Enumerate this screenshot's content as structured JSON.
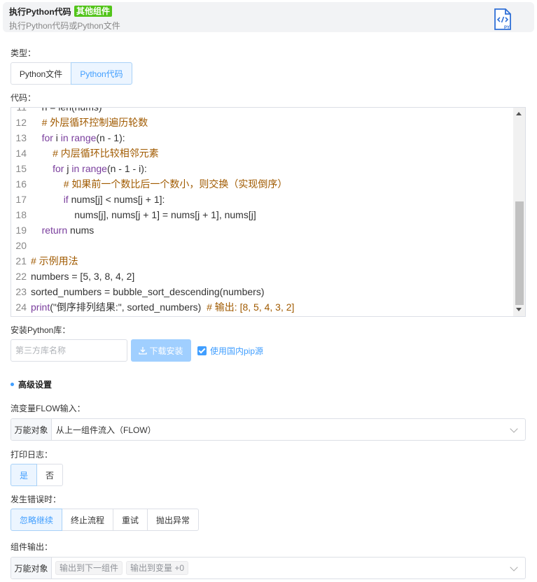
{
  "header": {
    "title": "执行Python代码",
    "badge": "其他组件",
    "subtitle": "执行Python代码或Python文件",
    "icon": "python-file-icon"
  },
  "type_field": {
    "label": "类型：",
    "options": [
      "Python文件",
      "Python代码"
    ],
    "selected": "Python代码"
  },
  "code_field": {
    "label": "代码：",
    "lines": [
      {
        "n": "11",
        "indent": "    ",
        "parts": [
          {
            "t": "n = len(nums)",
            "c": "code"
          }
        ]
      },
      {
        "n": "12",
        "indent": "    ",
        "parts": [
          {
            "t": "# 外层循环控制遍历轮数",
            "c": "cm"
          }
        ]
      },
      {
        "n": "13",
        "indent": "    ",
        "parts": [
          {
            "t": "for",
            "c": "kw"
          },
          {
            "t": " i ",
            "c": "code"
          },
          {
            "t": "in",
            "c": "kw"
          },
          {
            "t": " ",
            "c": "code"
          },
          {
            "t": "range",
            "c": "kw"
          },
          {
            "t": "(n - 1):",
            "c": "code"
          }
        ]
      },
      {
        "n": "14",
        "indent": "        ",
        "parts": [
          {
            "t": "# 内层循环比较相邻元素",
            "c": "cm"
          }
        ]
      },
      {
        "n": "15",
        "indent": "        ",
        "parts": [
          {
            "t": "for",
            "c": "kw"
          },
          {
            "t": " j ",
            "c": "code"
          },
          {
            "t": "in",
            "c": "kw"
          },
          {
            "t": " ",
            "c": "code"
          },
          {
            "t": "range",
            "c": "kw"
          },
          {
            "t": "(n - 1 - i):",
            "c": "code"
          }
        ]
      },
      {
        "n": "16",
        "indent": "            ",
        "parts": [
          {
            "t": "# 如果前一个数比后一个数小，则交换（实现倒序）",
            "c": "cm"
          }
        ]
      },
      {
        "n": "17",
        "indent": "            ",
        "parts": [
          {
            "t": "if",
            "c": "kw"
          },
          {
            "t": " nums[j] < nums[j + 1]:",
            "c": "code"
          }
        ]
      },
      {
        "n": "18",
        "indent": "                ",
        "parts": [
          {
            "t": "nums[j], nums[j + 1] = nums[j + 1], nums[j]",
            "c": "code"
          }
        ]
      },
      {
        "n": "19",
        "indent": "    ",
        "parts": [
          {
            "t": "return",
            "c": "kw"
          },
          {
            "t": " nums",
            "c": "code"
          }
        ]
      },
      {
        "n": "20",
        "indent": "",
        "parts": []
      },
      {
        "n": "21",
        "indent": "",
        "parts": [
          {
            "t": "# 示例用法",
            "c": "cm"
          }
        ]
      },
      {
        "n": "22",
        "indent": "",
        "parts": [
          {
            "t": "numbers = [5, 3, 8, 4, 2]",
            "c": "code"
          }
        ]
      },
      {
        "n": "23",
        "indent": "",
        "parts": [
          {
            "t": "sorted_numbers = bubble_sort_descending(numbers)",
            "c": "code"
          }
        ]
      },
      {
        "n": "24",
        "indent": "",
        "parts": [
          {
            "t": "print",
            "c": "kw"
          },
          {
            "t": "(\"倒序排列结果:\", sorted_numbers)  ",
            "c": "code"
          },
          {
            "t": "# 输出: [8, 5, 4, 3, 2]",
            "c": "cm"
          }
        ]
      }
    ]
  },
  "install": {
    "label": "安装Python库：",
    "placeholder": "第三方库名称",
    "button": "下载安装",
    "checkbox_label": "使用国内pip源",
    "checkbox_checked": true
  },
  "advanced": {
    "title": "高级设置"
  },
  "flow_input": {
    "label": "流变量FLOW输入：",
    "prefix": "万能对象",
    "value": "从上一组件流入（FLOW）"
  },
  "print_log": {
    "label": "打印日志：",
    "options": [
      "是",
      "否"
    ],
    "selected": "是"
  },
  "on_error": {
    "label": "发生错误时：",
    "options": [
      "忽略继续",
      "终止流程",
      "重试",
      "抛出异常"
    ],
    "selected": "忽略继续"
  },
  "output": {
    "label": "组件输出：",
    "prefix": "万能对象",
    "tags": [
      "输出到下一组件",
      "输出到变量 +0"
    ]
  },
  "colors": {
    "accent": "#409eff",
    "badge": "#52c41a",
    "keyword": "#7a3e9d",
    "comment": "#a05a00"
  }
}
